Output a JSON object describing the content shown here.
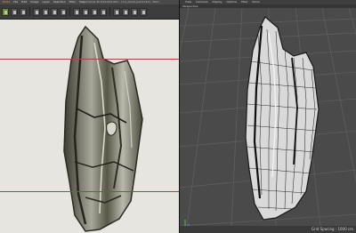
{
  "left_window": {
    "title": "— Cinema 4D R19.024 (RC) - [ice_shard_paint.c4d] - Main",
    "menu": [
      "File",
      "Edit",
      "Image",
      "Layer",
      "Selection",
      "Filter",
      "Help"
    ],
    "accent_menu": "Mode",
    "tools": [
      "move",
      "paint",
      "erase",
      "fill",
      "select",
      "transform",
      "zoom",
      "pan",
      "brush",
      "clone",
      "smudge",
      "layers",
      "channels",
      "settings",
      "view"
    ]
  },
  "right_window": {
    "menu": [
      "View",
      "Cameras",
      "Display",
      "Options",
      "Filter",
      "Panel"
    ],
    "viewport_label": "Perspective",
    "grid_spacing": "Grid Spacing : 1000 cm"
  },
  "colors": {
    "canvas_bg": "#e6e5df",
    "guide_line": "#b04040",
    "viewport_bg": "#4a4a4a",
    "grid_line": "#5c5c5c",
    "accent_menu": "#ff8a3d"
  }
}
